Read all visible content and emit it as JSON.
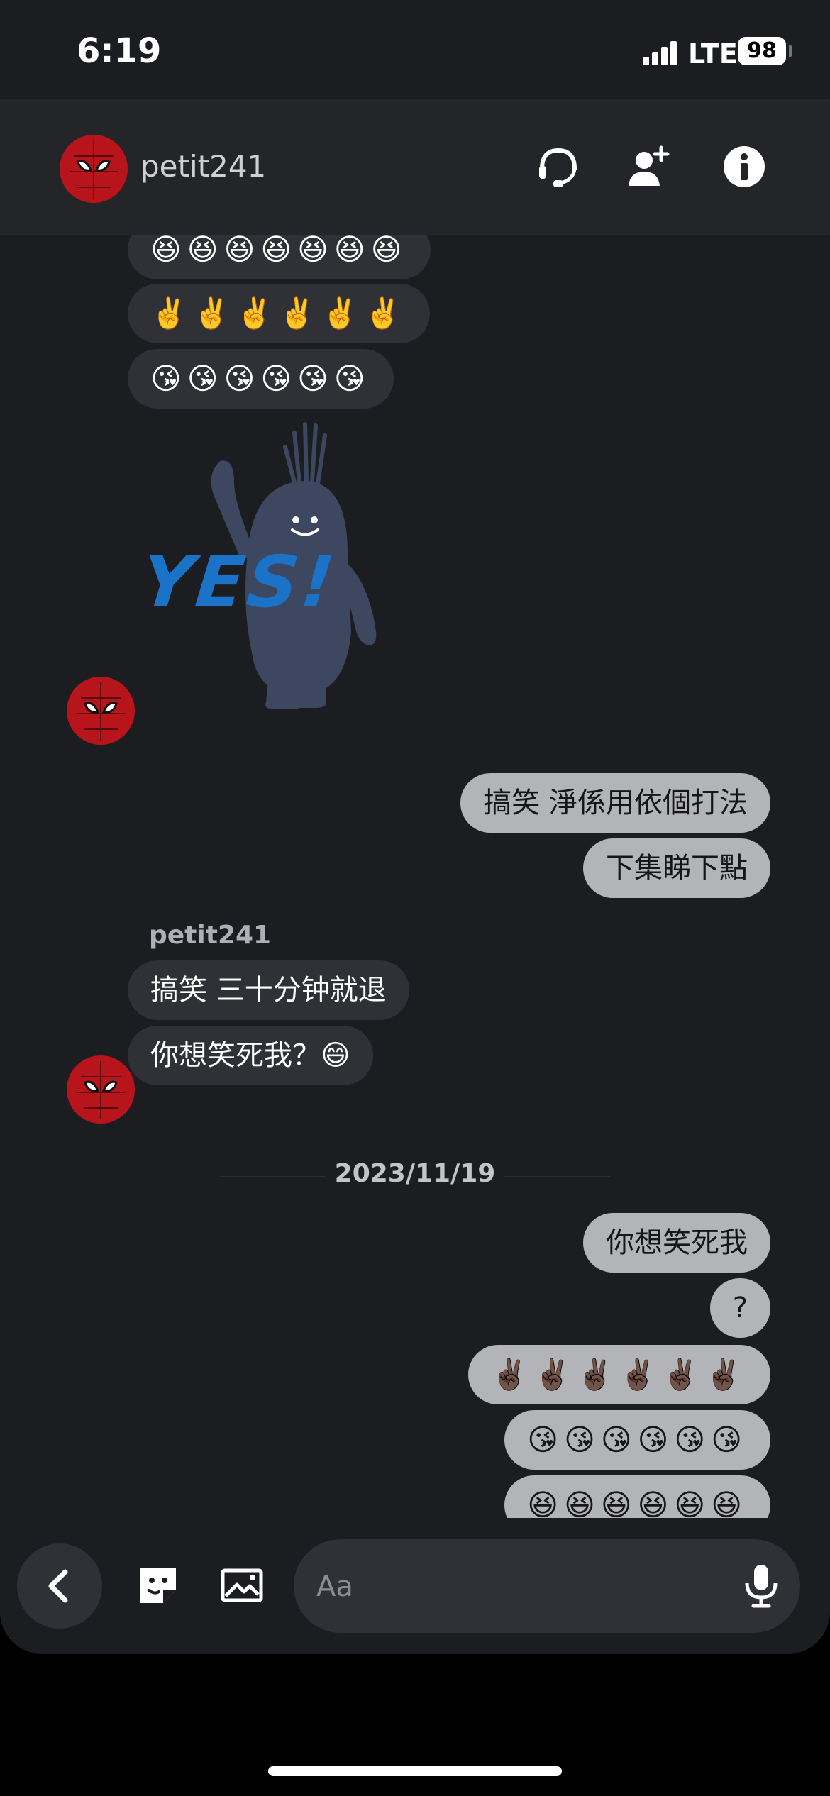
{
  "status": {
    "time": "6:19",
    "network": "LTE",
    "battery": "98"
  },
  "header": {
    "contact_name": "petit241"
  },
  "messages": {
    "grin_row": "😆😆😆😆😆😆😆",
    "peace_row": "✌️✌️✌️✌️✌️✌️",
    "kiss_row": "😘😘😘😘😘😘",
    "sticker_text": "YES!",
    "out1": "搞笑 淨係用依個打法",
    "out2": "下集睇下點",
    "sender": "petit241",
    "in1": "搞笑 三十分钟就退",
    "in2": "你想笑死我？😄",
    "date": "2023/11/19",
    "out3": "你想笑死我",
    "out4": "?",
    "out5": "✌🏿✌🏿✌🏿✌🏿✌🏿✌🏿",
    "out6": "😘😘😘😘😘😘",
    "out7": "😆😆😆😆😆😆"
  },
  "composer": {
    "placeholder": "Aa"
  },
  "icons": [
    "headset-icon",
    "add-person-icon",
    "info-icon",
    "back-icon",
    "sticker-icon",
    "image-icon",
    "microphone-icon"
  ],
  "colors": {
    "background": "#1c1d20",
    "header": "#242528",
    "incoming_bubble": "#303136",
    "outgoing_bubble": "#b3b4b8"
  }
}
